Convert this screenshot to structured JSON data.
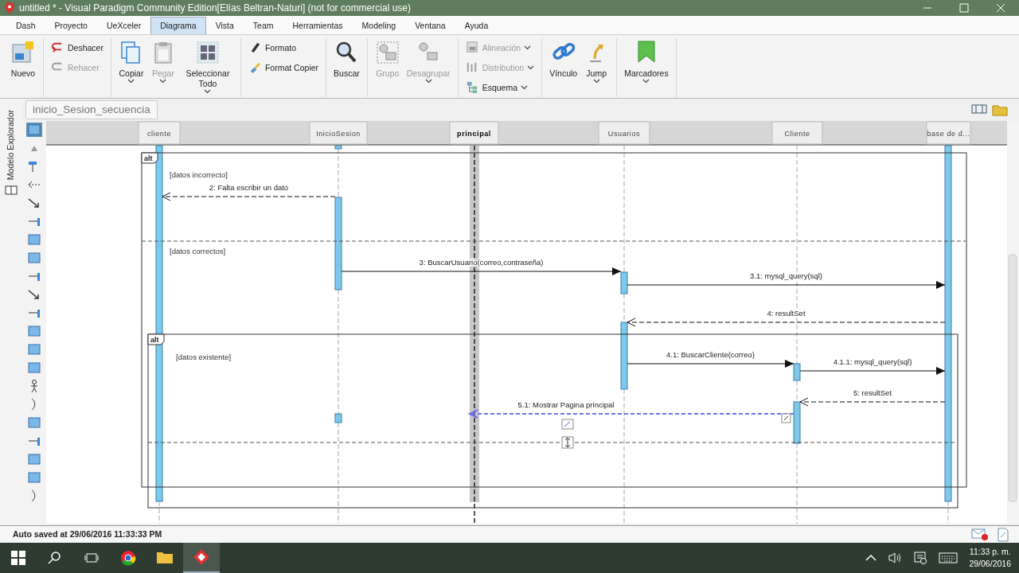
{
  "window": {
    "title": "untitled * - Visual Paradigm Community Edition[Elías Beltran-Naturi] (not for commercial use)"
  },
  "menu_tabs": [
    {
      "label": "Dash",
      "selected": false
    },
    {
      "label": "Proyecto",
      "selected": false
    },
    {
      "label": "UeXceler",
      "selected": false
    },
    {
      "label": "Diagrama",
      "selected": true
    },
    {
      "label": "Vista",
      "selected": false
    },
    {
      "label": "Team",
      "selected": false
    },
    {
      "label": "Herramientas",
      "selected": false
    },
    {
      "label": "Modeling",
      "selected": false
    },
    {
      "label": "Ventana",
      "selected": false
    },
    {
      "label": "Ayuda",
      "selected": false
    }
  ],
  "ribbon": [
    {
      "kind": "large",
      "items": [
        {
          "label": "Nuevo",
          "disabled": false,
          "dropdown": false
        }
      ]
    },
    {
      "kind": "stack",
      "items": [
        {
          "label": "Deshacer",
          "disabled": false,
          "dropdown": false
        },
        {
          "label": "Rehacer",
          "disabled": true,
          "dropdown": false
        }
      ]
    },
    {
      "kind": "large",
      "items": [
        {
          "label": "Copiar",
          "disabled": false,
          "dropdown": true
        },
        {
          "label": "Pegar",
          "disabled": true,
          "dropdown": true
        },
        {
          "label": "Seleccionar Todo",
          "disabled": false,
          "dropdown": true
        }
      ]
    },
    {
      "kind": "stack",
      "items": [
        {
          "label": "Formato",
          "disabled": false,
          "dropdown": false
        },
        {
          "label": "Format Copier",
          "disabled": false,
          "dropdown": false
        }
      ]
    },
    {
      "kind": "large",
      "items": [
        {
          "label": "Buscar",
          "disabled": false,
          "dropdown": false
        }
      ]
    },
    {
      "kind": "large",
      "items": [
        {
          "label": "Grupo",
          "disabled": true,
          "dropdown": false
        },
        {
          "label": "Desagrupar",
          "disabled": true,
          "dropdown": true
        }
      ]
    },
    {
      "kind": "stack",
      "items": [
        {
          "label": "Alineación",
          "disabled": true,
          "dropdown": true
        },
        {
          "label": "Distribution",
          "disabled": true,
          "dropdown": true
        },
        {
          "label": "Esquema",
          "disabled": false,
          "dropdown": true
        }
      ]
    },
    {
      "kind": "large",
      "items": [
        {
          "label": "Vínculo",
          "disabled": false,
          "dropdown": false
        },
        {
          "label": "Jump",
          "disabled": false,
          "dropdown": true
        }
      ]
    },
    {
      "kind": "large",
      "items": [
        {
          "label": "Marcadores",
          "disabled": false,
          "dropdown": true
        }
      ]
    }
  ],
  "side_panel": {
    "label": "Modelo Explorador"
  },
  "diagram_tab": {
    "label": "inicio_Sesion_secuencia"
  },
  "palette": [
    {
      "selected": true
    },
    {
      "selected": false
    },
    {
      "selected": false
    },
    {
      "selected": false
    },
    {
      "selected": false
    },
    {
      "selected": false
    },
    {
      "selected": false
    },
    {
      "selected": false
    },
    {
      "selected": false
    },
    {
      "selected": false
    },
    {
      "selected": false
    },
    {
      "selected": false
    },
    {
      "selected": false
    },
    {
      "selected": false
    },
    {
      "selected": false
    },
    {
      "selected": false
    },
    {
      "selected": false
    },
    {
      "selected": false
    },
    {
      "selected": false
    },
    {
      "selected": false
    },
    {
      "selected": false
    }
  ],
  "diagram": {
    "lifelines": [
      {
        "name": "cliente",
        "selected": false
      },
      {
        "name": "InicioSesion",
        "selected": false
      },
      {
        "name": "principal",
        "selected": true
      },
      {
        "name": "Usuarios",
        "selected": false
      },
      {
        "name": "Cliente",
        "selected": false
      },
      {
        "name": "base de d...",
        "selected": false
      }
    ],
    "fragments": [
      {
        "operator": "alt",
        "guards": [
          "[datos incorrecto]",
          "[datos correctos]"
        ]
      },
      {
        "operator": "alt",
        "guards": [
          "[datos existente]"
        ]
      }
    ],
    "messages": [
      {
        "label": "2: Falta escribir un dato",
        "kind": "return",
        "selected": false
      },
      {
        "label": "3: BuscarUsuario(correo,contraseña)",
        "kind": "call",
        "selected": false
      },
      {
        "label": "3.1: mysql_query(sql)",
        "kind": "call",
        "selected": false
      },
      {
        "label": "4: resultSet",
        "kind": "return",
        "selected": false
      },
      {
        "label": "4.1: BuscarCliente(correo)",
        "kind": "call",
        "selected": false
      },
      {
        "label": "4.1.1: mysql_query(sql)",
        "kind": "call",
        "selected": false
      },
      {
        "label": "5: resultSet",
        "kind": "return",
        "selected": false
      },
      {
        "label": "5.1: Mostrar Pagina principal",
        "kind": "return",
        "selected": true
      }
    ]
  },
  "status_bar": {
    "text": "Auto saved at 29/06/2016 11:33:33 PM"
  },
  "taskbar": {
    "apps": [
      {
        "selected": false
      },
      {
        "selected": false
      },
      {
        "selected": true
      }
    ],
    "time": "11:33 p. m.",
    "date": "29/06/2016"
  }
}
